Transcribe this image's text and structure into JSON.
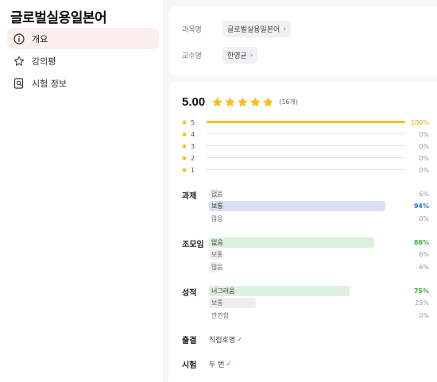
{
  "course": {
    "title": "글로벌실용일본어"
  },
  "sidebar": {
    "items": [
      {
        "label": "개요",
        "active": true,
        "icon": "info-circle-icon"
      },
      {
        "label": "강의평",
        "active": false,
        "icon": "star-outline-icon"
      },
      {
        "label": "시험 정보",
        "active": false,
        "icon": "search-doc-icon"
      }
    ]
  },
  "info": {
    "course_label": "과목명",
    "course_value": "글로벌실용일본어",
    "prof_label": "교수명",
    "prof_value": "한영균"
  },
  "rating": {
    "score": "5.00",
    "stars": 5,
    "count": "(16개)",
    "distribution": [
      {
        "star": "5",
        "percent": "100%",
        "value": 1.0
      },
      {
        "star": "4",
        "percent": "0%",
        "value": 0
      },
      {
        "star": "3",
        "percent": "0%",
        "value": 0
      },
      {
        "star": "2",
        "percent": "0%",
        "value": 0
      },
      {
        "star": "1",
        "percent": "0%",
        "value": 0
      }
    ]
  },
  "sections": {
    "assignment": {
      "label": "과제",
      "options": [
        {
          "text": "없음",
          "percent": "6%",
          "value": 0.06
        },
        {
          "text": "보통",
          "percent": "94%",
          "value": 0.94
        },
        {
          "text": "많음",
          "percent": "0%",
          "value": 0
        }
      ]
    },
    "team": {
      "label": "조모임",
      "options": [
        {
          "text": "없음",
          "percent": "88%",
          "value": 0.88
        },
        {
          "text": "보통",
          "percent": "6%",
          "value": 0.06
        },
        {
          "text": "많음",
          "percent": "6%",
          "value": 0.06
        }
      ]
    },
    "grade": {
      "label": "성적",
      "options": [
        {
          "text": "너그러움",
          "percent": "75%",
          "value": 0.75
        },
        {
          "text": "보통",
          "percent": "25%",
          "value": 0.25
        },
        {
          "text": "깐깐함",
          "percent": "0%",
          "value": 0
        }
      ]
    }
  },
  "attendance": {
    "label": "출결",
    "value": "직접호명"
  },
  "exam": {
    "label": "시험",
    "value": "두 번"
  },
  "colors": {
    "star": "#f5bf1b",
    "blue_bar": "#d9dff0",
    "blue_text": "#2f6fd6",
    "green_bar": "#dcf1dc",
    "green_text": "#3bb54a",
    "gray_bar": "#efefef",
    "active_nav": "#fdeeee"
  }
}
